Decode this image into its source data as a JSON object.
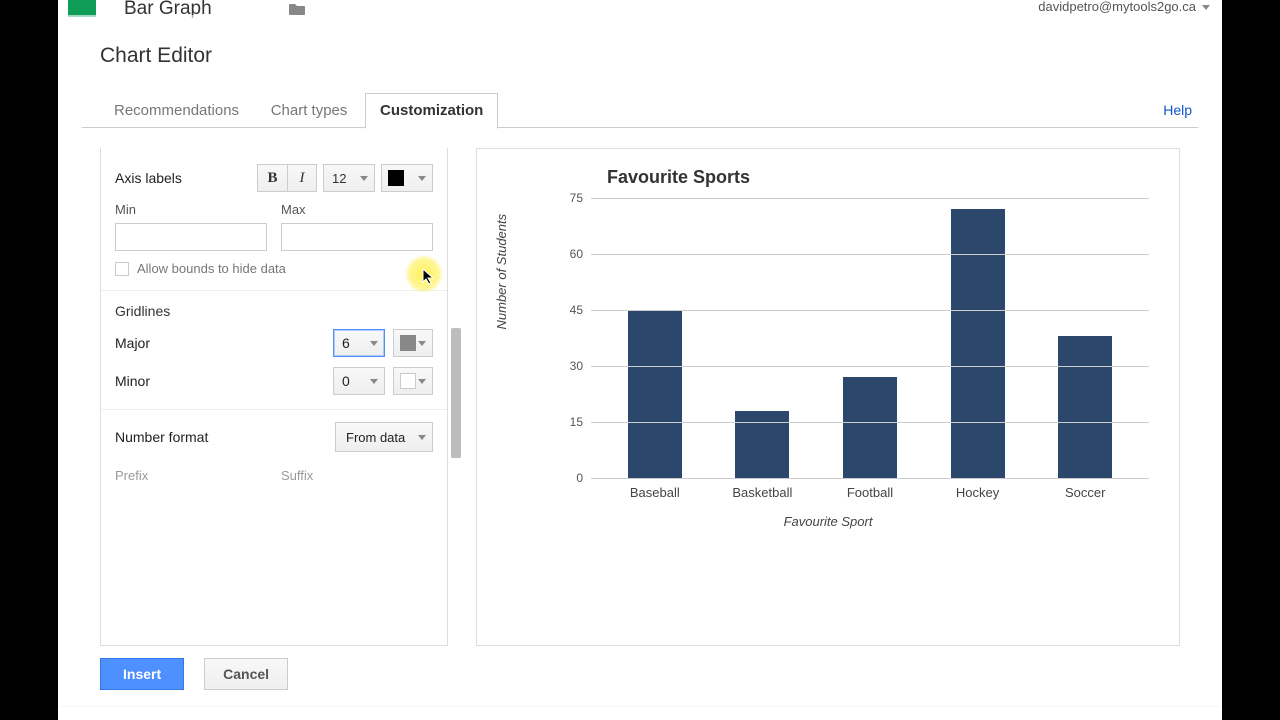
{
  "doc_title": "Bar Graph",
  "account_email": "davidpetro@mytools2go.ca",
  "dialog": {
    "title": "Chart Editor",
    "help": "Help"
  },
  "tabs": {
    "recommendations": "Recommendations",
    "types": "Chart types",
    "custom": "Customization"
  },
  "axis": {
    "section_label": "Axis labels",
    "font_size": "12",
    "min_label": "Min",
    "max_label": "Max",
    "min_value": "",
    "max_value": "",
    "allow_bounds": "Allow bounds to hide data"
  },
  "gridlines": {
    "section_label": "Gridlines",
    "major_label": "Major",
    "minor_label": "Minor",
    "major_value": "6",
    "minor_value": "0"
  },
  "numfmt": {
    "section_label": "Number format",
    "from_data": "From data",
    "prefix_label": "Prefix",
    "suffix_label": "Suffix"
  },
  "footer": {
    "insert": "Insert",
    "cancel": "Cancel"
  },
  "chart_data": {
    "type": "bar",
    "title": "Favourite Sports",
    "xlabel": "Favourite Sport",
    "ylabel": "Number of Students",
    "categories": [
      "Baseball",
      "Basketball",
      "Football",
      "Hockey",
      "Soccer"
    ],
    "values": [
      45,
      18,
      27,
      72,
      38
    ],
    "yticks": [
      0,
      15,
      30,
      45,
      60,
      75
    ],
    "ylim": [
      0,
      75
    ],
    "color": "#2b476b"
  }
}
